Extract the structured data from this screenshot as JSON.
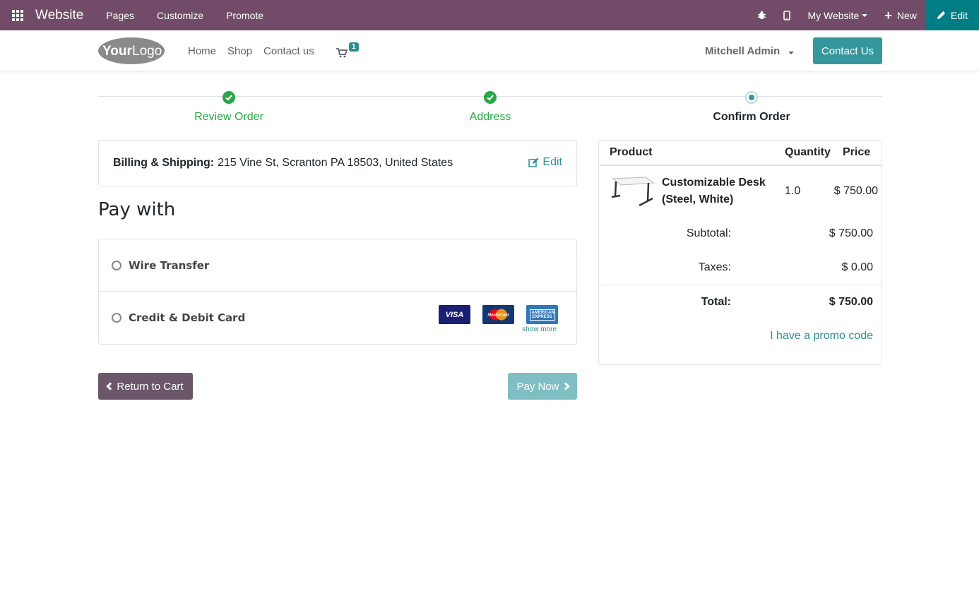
{
  "topbar": {
    "brand": "Website",
    "menus": [
      "Pages",
      "Customize",
      "Promote"
    ],
    "website_selector": "My Website",
    "new_label": "New",
    "edit_label": "Edit"
  },
  "header": {
    "logo_text": "YourLogo",
    "nav": [
      "Home",
      "Shop",
      "Contact us"
    ],
    "cart_count": "1",
    "user": "Mitchell Admin",
    "contact_button": "Contact Us"
  },
  "steps": [
    {
      "label": "Review Order",
      "state": "done"
    },
    {
      "label": "Address",
      "state": "done"
    },
    {
      "label": "Confirm Order",
      "state": "current"
    }
  ],
  "address": {
    "label": "Billing & Shipping:",
    "value": "215 Vine St, Scranton PA 18503, United States",
    "edit_label": "Edit"
  },
  "payment": {
    "title": "Pay with",
    "options": [
      "Wire Transfer",
      "Credit & Debit Card"
    ],
    "card_brands": [
      "VISA",
      "MasterCard",
      "AMERICAN EXPRESS"
    ],
    "show_more": "show more"
  },
  "actions": {
    "return_label": "Return to Cart",
    "pay_label": "Pay Now"
  },
  "summary": {
    "headers": {
      "product": "Product",
      "quantity": "Quantity",
      "price": "Price"
    },
    "item": {
      "name": "Customizable Desk (Steel, White)",
      "qty": "1.0",
      "price": "$ 750.00"
    },
    "subtotal_label": "Subtotal:",
    "subtotal": "$ 750.00",
    "taxes_label": "Taxes:",
    "taxes": "$ 0.00",
    "total_label": "Total:",
    "total": "$ 750.00",
    "promo": "I have a promo code"
  },
  "colors": {
    "topbar": "#714B67",
    "edit_button": "#017E84",
    "accent": "#35979c",
    "success": "#28a745",
    "return_button": "#6b5769"
  }
}
